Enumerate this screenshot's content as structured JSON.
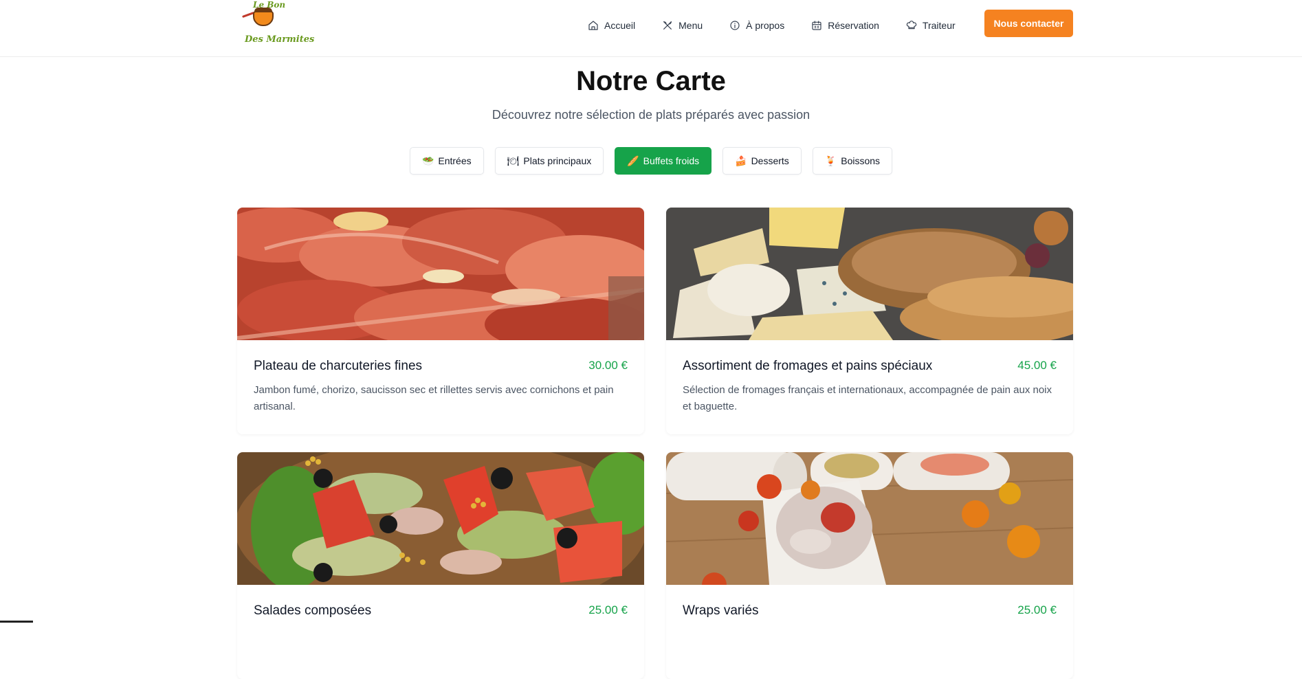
{
  "brand": {
    "logo_top": "Le Bon",
    "logo_bottom": "Des Marmites"
  },
  "nav": {
    "items": [
      {
        "label": "Accueil",
        "icon": "home-icon"
      },
      {
        "label": "Menu",
        "icon": "utensils-icon"
      },
      {
        "label": "À propos",
        "icon": "info-icon"
      },
      {
        "label": "Réservation",
        "icon": "calendar-icon"
      },
      {
        "label": "Traiteur",
        "icon": "chef-hat-icon"
      }
    ],
    "cta": "Nous contacter"
  },
  "page": {
    "title": "Notre Carte",
    "subtitle": "Découvrez notre sélection de plats préparés avec passion"
  },
  "tabs": [
    {
      "label": "Entrées",
      "icon": "salad-icon",
      "glyph": "🥗",
      "active": false
    },
    {
      "label": "Plats principaux",
      "icon": "plate-icon",
      "glyph": "🍽",
      "active": false
    },
    {
      "label": "Buffets froids",
      "icon": "baguette-icon",
      "glyph": "🥖",
      "active": true
    },
    {
      "label": "Desserts",
      "icon": "cake-icon",
      "glyph": "🍰",
      "active": false
    },
    {
      "label": "Boissons",
      "icon": "cocktail-icon",
      "glyph": "🍹",
      "active": false
    }
  ],
  "items": [
    {
      "title": "Plateau de charcuteries fines",
      "price": "30.00 €",
      "description": "Jambon fumé, chorizo, saucisson sec et rillettes servis avec cornichons et pain artisanal."
    },
    {
      "title": "Assortiment de fromages et pains spéciaux",
      "price": "45.00 €",
      "description": "Sélection de fromages français et internationaux, accompagnée de pain aux noix et baguette."
    },
    {
      "title": "Salades composées",
      "price": "25.00 €",
      "description": ""
    },
    {
      "title": "Wraps variés",
      "price": "25.00 €",
      "description": ""
    }
  ],
  "colors": {
    "accent_orange": "#f58220",
    "accent_green": "#16a34a",
    "text_dark": "#111827",
    "text_muted": "#4b5563"
  }
}
